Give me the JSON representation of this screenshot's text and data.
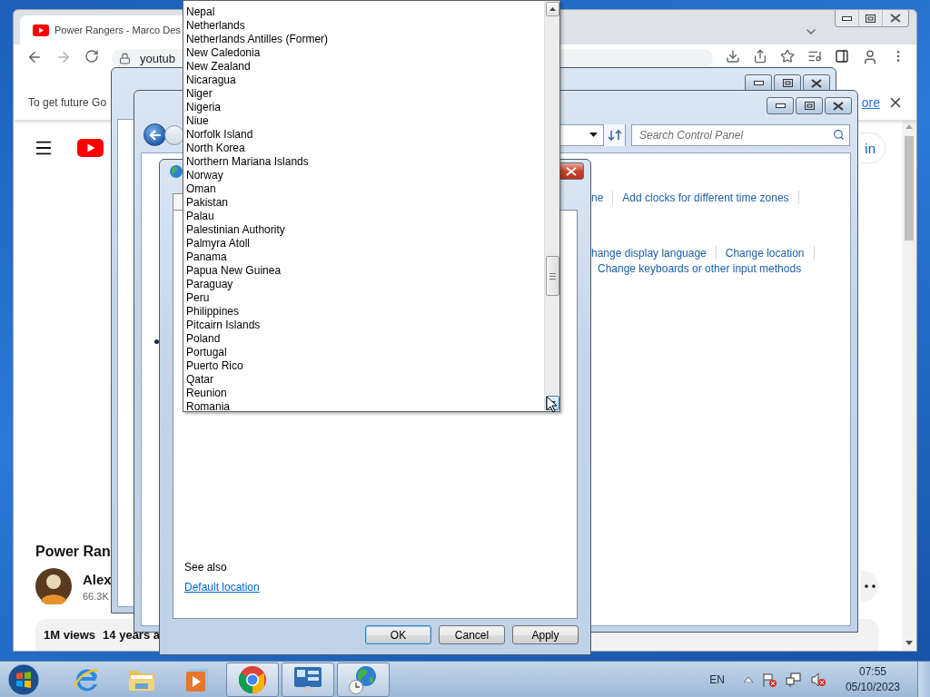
{
  "browser": {
    "tab_title": "Power Rangers - Marco Des",
    "address": "youtub",
    "infobar": {
      "text": "To get future Go",
      "link": "ore"
    },
    "signin": "in",
    "video": {
      "title": "Power Ran",
      "channel": "Alex",
      "subscribers": "66.3K",
      "views": "1M views",
      "age": "14 years a"
    }
  },
  "control_panel": {
    "search": {
      "placeholder": "Search Control Panel"
    },
    "link_rows": [
      {
        "separators": true,
        "links": [
          "ne",
          "Add clocks for different time zones"
        ]
      },
      {
        "separators": true,
        "links": [
          "hange display language",
          "Change location"
        ]
      },
      {
        "separators": false,
        "links": [
          "Change keyboards or other input methods"
        ]
      }
    ]
  },
  "region_dialog": {
    "see_also": "See also",
    "link": "Default location",
    "buttons": [
      {
        "label": "OK",
        "default": true
      },
      {
        "label": "Cancel",
        "default": false
      },
      {
        "label": "Apply",
        "default": false
      }
    ]
  },
  "country_list": {
    "items": [
      "Nepal",
      "Netherlands",
      "Netherlands Antilles (Former)",
      "New Caledonia",
      "New Zealand",
      "Nicaragua",
      "Niger",
      "Nigeria",
      "Niue",
      "Norfolk Island",
      "North Korea",
      "Northern Mariana Islands",
      "Norway",
      "Oman",
      "Pakistan",
      "Palau",
      "Palestinian Authority",
      "Palmyra Atoll",
      "Panama",
      "Papua New Guinea",
      "Paraguay",
      "Peru",
      "Philippines",
      "Pitcairn Islands",
      "Poland",
      "Portugal",
      "Puerto Rico",
      "Qatar",
      "Reunion",
      "Romania"
    ]
  },
  "taskbar": {
    "apps": [
      {
        "kind": "ie",
        "open": false
      },
      {
        "kind": "explorer",
        "open": false
      },
      {
        "kind": "media",
        "open": false
      },
      {
        "kind": "chrome",
        "open": true
      },
      {
        "kind": "control-panel",
        "open": true
      },
      {
        "kind": "region",
        "open": true
      }
    ],
    "tray": {
      "language": "EN",
      "time": "07:55",
      "date": "05/10/2023"
    }
  }
}
